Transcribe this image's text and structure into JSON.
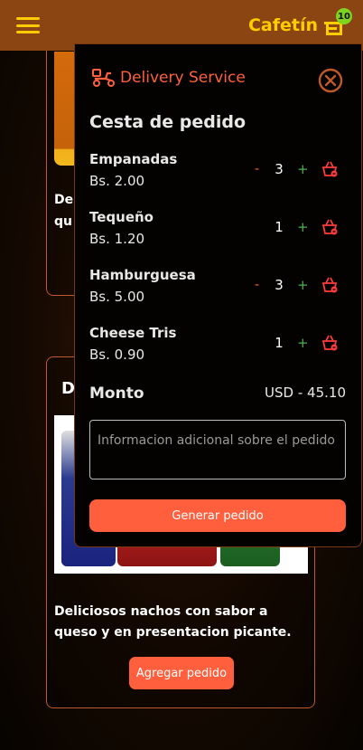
{
  "header": {
    "brand": "Cafetín",
    "cart_count": "10"
  },
  "background": {
    "card1_desc_line1": "De",
    "card1_desc_line2": "qu",
    "card2_title": "D",
    "card2_desc": "Deliciosos nachos con sabor a queso y en presentacion picante.",
    "card2_button": "Agregar pedido"
  },
  "panel": {
    "title": "Delivery Service",
    "basket_title": "Cesta de pedido",
    "items": [
      {
        "name": "Empanadas",
        "price": "Bs. 2.00",
        "qty": "3",
        "minus": "-",
        "plus": "+"
      },
      {
        "name": "Tequeño",
        "price": "Bs. 1.20",
        "qty": "1",
        "minus": "",
        "plus": "+"
      },
      {
        "name": "Hamburguesa",
        "price": "Bs. 5.00",
        "qty": "3",
        "minus": "-",
        "plus": "+"
      },
      {
        "name": "Cheese Tris",
        "price": "Bs. 0.90",
        "qty": "1",
        "minus": "",
        "plus": "+"
      }
    ],
    "amount_label": "Monto",
    "amount_value": "USD - 45.10",
    "info_placeholder": "Informacion adicional sobre el pedido",
    "generate_button": "Generar pedido"
  },
  "colors": {
    "header_bg": "#8b4513",
    "brand": "#ffcc00",
    "accent": "#ff5f3d",
    "plus": "#4caf50",
    "badge": "#7ed321"
  },
  "icons": {
    "menu": "hamburger-icon",
    "cart": "cart-icon",
    "delivery": "delivery-scooter-icon",
    "close": "close-circle-icon",
    "remove": "basket-remove-icon"
  }
}
